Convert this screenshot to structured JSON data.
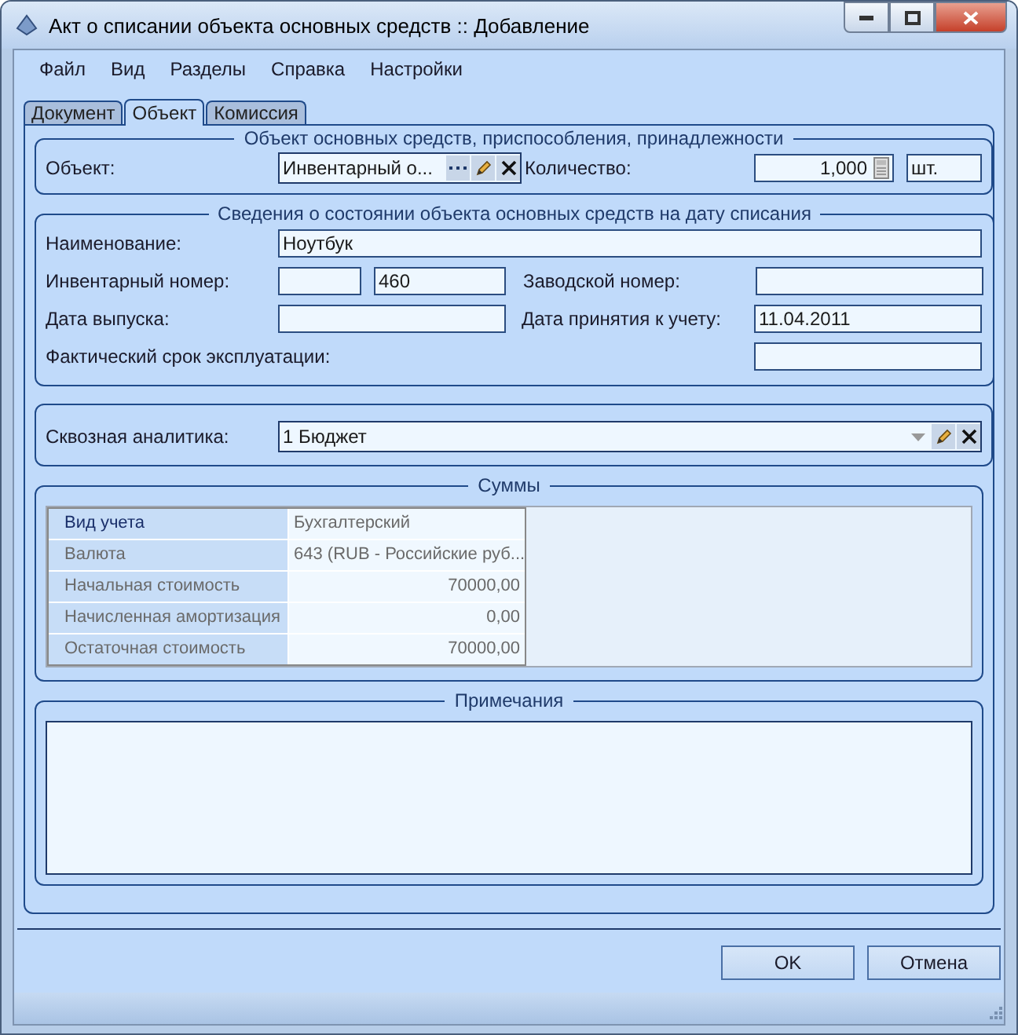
{
  "window": {
    "title": "Акт о списании объекта основных средств :: Добавление"
  },
  "menu": [
    {
      "label": "Файл"
    },
    {
      "label": "Вид"
    },
    {
      "label": "Разделы"
    },
    {
      "label": "Справка"
    },
    {
      "label": "Настройки"
    }
  ],
  "tabs": [
    {
      "label": "Документ",
      "selected": false
    },
    {
      "label": "Объект",
      "selected": true
    },
    {
      "label": "Комиссия",
      "selected": false
    }
  ],
  "object_group": {
    "legend": "Объект основных средств, приспособления, принадлежности",
    "object_label": "Объект:",
    "object_value": "Инвентарный о...",
    "quantity_label": "Количество:",
    "quantity_value": "1,000",
    "unit_value": "шт."
  },
  "details_group": {
    "legend": "Сведения о состоянии объекта основных средств на дату списания",
    "name_label": "Наименование:",
    "name_value": "Ноутбук",
    "inventory_label": "Инвентарный номер:",
    "inventory_number_value": "460",
    "serial_label": "Заводской номер:",
    "release_date_label": "Дата выпуска:",
    "accepted_date_label": "Дата принятия к учету:",
    "accepted_date_value": "11.04.2011",
    "service_life_label": "Фактический срок эксплуатации:"
  },
  "analytics": {
    "label": "Сквозная аналитика:",
    "value": "1 Бюджет"
  },
  "sums": {
    "legend": "Суммы",
    "rows": [
      {
        "label": "Вид учета",
        "value": "Бухгалтерский",
        "kind": "text",
        "selected": true
      },
      {
        "label": "Валюта",
        "value": "643 (RUB - Российские руб...",
        "kind": "text",
        "selected": false
      },
      {
        "label": "Начальная стоимость",
        "value": "70000,00",
        "kind": "number",
        "selected": false
      },
      {
        "label": "Начисленная амортизация",
        "value": "0,00",
        "kind": "number",
        "selected": false
      },
      {
        "label": "Остаточная стоимость",
        "value": "70000,00",
        "kind": "number",
        "selected": false
      }
    ]
  },
  "notes": {
    "legend": "Примечания"
  },
  "buttons": [
    {
      "label": "OK"
    },
    {
      "label": "Отмена"
    }
  ]
}
